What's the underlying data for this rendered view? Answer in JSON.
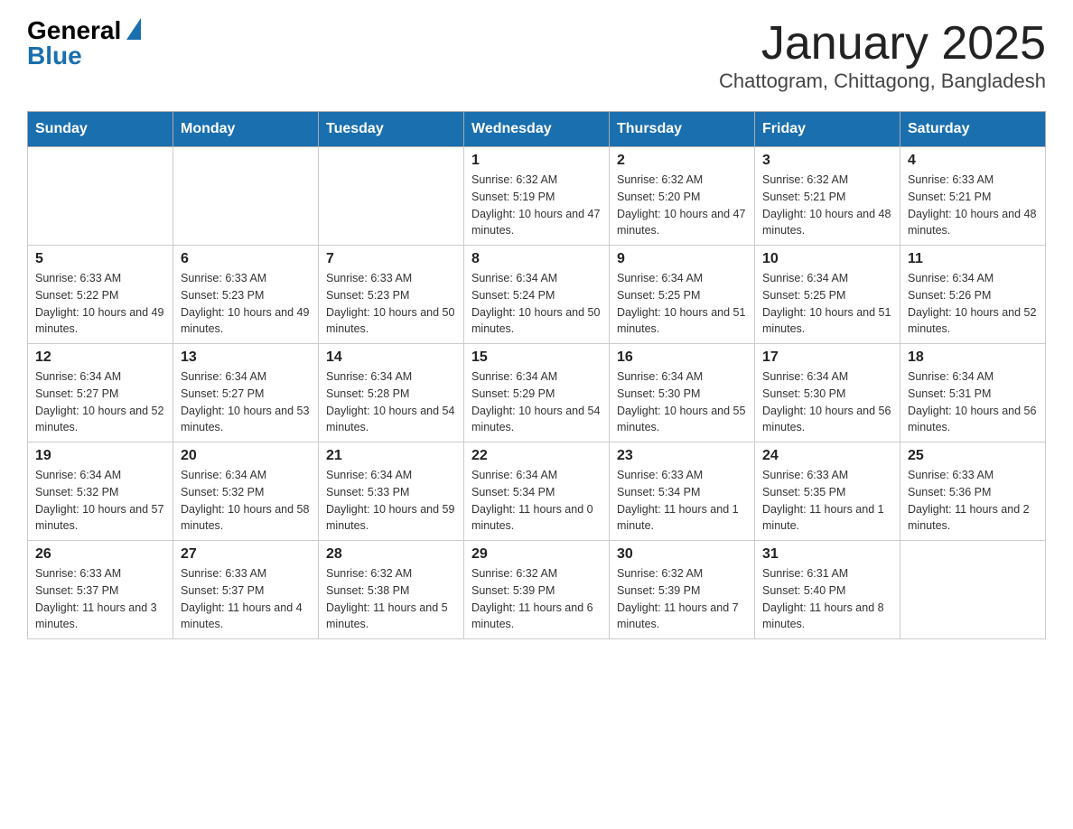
{
  "header": {
    "logo_general": "General",
    "logo_blue": "Blue",
    "title": "January 2025",
    "subtitle": "Chattogram, Chittagong, Bangladesh"
  },
  "days_of_week": [
    "Sunday",
    "Monday",
    "Tuesday",
    "Wednesday",
    "Thursday",
    "Friday",
    "Saturday"
  ],
  "weeks": [
    [
      {
        "day": "",
        "info": ""
      },
      {
        "day": "",
        "info": ""
      },
      {
        "day": "",
        "info": ""
      },
      {
        "day": "1",
        "info": "Sunrise: 6:32 AM\nSunset: 5:19 PM\nDaylight: 10 hours and 47 minutes."
      },
      {
        "day": "2",
        "info": "Sunrise: 6:32 AM\nSunset: 5:20 PM\nDaylight: 10 hours and 47 minutes."
      },
      {
        "day": "3",
        "info": "Sunrise: 6:32 AM\nSunset: 5:21 PM\nDaylight: 10 hours and 48 minutes."
      },
      {
        "day": "4",
        "info": "Sunrise: 6:33 AM\nSunset: 5:21 PM\nDaylight: 10 hours and 48 minutes."
      }
    ],
    [
      {
        "day": "5",
        "info": "Sunrise: 6:33 AM\nSunset: 5:22 PM\nDaylight: 10 hours and 49 minutes."
      },
      {
        "day": "6",
        "info": "Sunrise: 6:33 AM\nSunset: 5:23 PM\nDaylight: 10 hours and 49 minutes."
      },
      {
        "day": "7",
        "info": "Sunrise: 6:33 AM\nSunset: 5:23 PM\nDaylight: 10 hours and 50 minutes."
      },
      {
        "day": "8",
        "info": "Sunrise: 6:34 AM\nSunset: 5:24 PM\nDaylight: 10 hours and 50 minutes."
      },
      {
        "day": "9",
        "info": "Sunrise: 6:34 AM\nSunset: 5:25 PM\nDaylight: 10 hours and 51 minutes."
      },
      {
        "day": "10",
        "info": "Sunrise: 6:34 AM\nSunset: 5:25 PM\nDaylight: 10 hours and 51 minutes."
      },
      {
        "day": "11",
        "info": "Sunrise: 6:34 AM\nSunset: 5:26 PM\nDaylight: 10 hours and 52 minutes."
      }
    ],
    [
      {
        "day": "12",
        "info": "Sunrise: 6:34 AM\nSunset: 5:27 PM\nDaylight: 10 hours and 52 minutes."
      },
      {
        "day": "13",
        "info": "Sunrise: 6:34 AM\nSunset: 5:27 PM\nDaylight: 10 hours and 53 minutes."
      },
      {
        "day": "14",
        "info": "Sunrise: 6:34 AM\nSunset: 5:28 PM\nDaylight: 10 hours and 54 minutes."
      },
      {
        "day": "15",
        "info": "Sunrise: 6:34 AM\nSunset: 5:29 PM\nDaylight: 10 hours and 54 minutes."
      },
      {
        "day": "16",
        "info": "Sunrise: 6:34 AM\nSunset: 5:30 PM\nDaylight: 10 hours and 55 minutes."
      },
      {
        "day": "17",
        "info": "Sunrise: 6:34 AM\nSunset: 5:30 PM\nDaylight: 10 hours and 56 minutes."
      },
      {
        "day": "18",
        "info": "Sunrise: 6:34 AM\nSunset: 5:31 PM\nDaylight: 10 hours and 56 minutes."
      }
    ],
    [
      {
        "day": "19",
        "info": "Sunrise: 6:34 AM\nSunset: 5:32 PM\nDaylight: 10 hours and 57 minutes."
      },
      {
        "day": "20",
        "info": "Sunrise: 6:34 AM\nSunset: 5:32 PM\nDaylight: 10 hours and 58 minutes."
      },
      {
        "day": "21",
        "info": "Sunrise: 6:34 AM\nSunset: 5:33 PM\nDaylight: 10 hours and 59 minutes."
      },
      {
        "day": "22",
        "info": "Sunrise: 6:34 AM\nSunset: 5:34 PM\nDaylight: 11 hours and 0 minutes."
      },
      {
        "day": "23",
        "info": "Sunrise: 6:33 AM\nSunset: 5:34 PM\nDaylight: 11 hours and 1 minute."
      },
      {
        "day": "24",
        "info": "Sunrise: 6:33 AM\nSunset: 5:35 PM\nDaylight: 11 hours and 1 minute."
      },
      {
        "day": "25",
        "info": "Sunrise: 6:33 AM\nSunset: 5:36 PM\nDaylight: 11 hours and 2 minutes."
      }
    ],
    [
      {
        "day": "26",
        "info": "Sunrise: 6:33 AM\nSunset: 5:37 PM\nDaylight: 11 hours and 3 minutes."
      },
      {
        "day": "27",
        "info": "Sunrise: 6:33 AM\nSunset: 5:37 PM\nDaylight: 11 hours and 4 minutes."
      },
      {
        "day": "28",
        "info": "Sunrise: 6:32 AM\nSunset: 5:38 PM\nDaylight: 11 hours and 5 minutes."
      },
      {
        "day": "29",
        "info": "Sunrise: 6:32 AM\nSunset: 5:39 PM\nDaylight: 11 hours and 6 minutes."
      },
      {
        "day": "30",
        "info": "Sunrise: 6:32 AM\nSunset: 5:39 PM\nDaylight: 11 hours and 7 minutes."
      },
      {
        "day": "31",
        "info": "Sunrise: 6:31 AM\nSunset: 5:40 PM\nDaylight: 11 hours and 8 minutes."
      },
      {
        "day": "",
        "info": ""
      }
    ]
  ]
}
